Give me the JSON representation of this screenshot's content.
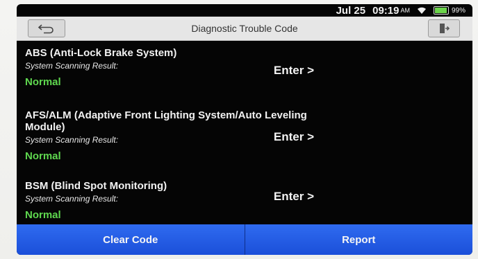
{
  "status_bar": {
    "date": "Jul 25",
    "time": "09:19",
    "ampm": "AM",
    "battery": "99%",
    "battery_level": 0.99
  },
  "header": {
    "title": "Diagnostic Trouble Code",
    "back_icon": "back-arrow-icon",
    "exit_icon": "exit-icon"
  },
  "systems": [
    {
      "name": "ABS (Anti-Lock Brake System)",
      "result_label": "System Scanning Result:",
      "status": "Normal",
      "enter_label": "Enter >"
    },
    {
      "name": "AFS/ALM (Adaptive Front Lighting System/Auto Leveling Module)",
      "result_label": "System Scanning Result:",
      "status": "Normal",
      "enter_label": "Enter >"
    },
    {
      "name": "BSM (Blind Spot Monitoring)",
      "result_label": "System Scanning Result:",
      "status": "Normal",
      "enter_label": "Enter >"
    }
  ],
  "footer": {
    "clear_code_label": "Clear Code",
    "report_label": "Report"
  },
  "colors": {
    "status_ok": "#5fd84f",
    "primary_button": "#2f6bf0",
    "background": "#050505"
  }
}
